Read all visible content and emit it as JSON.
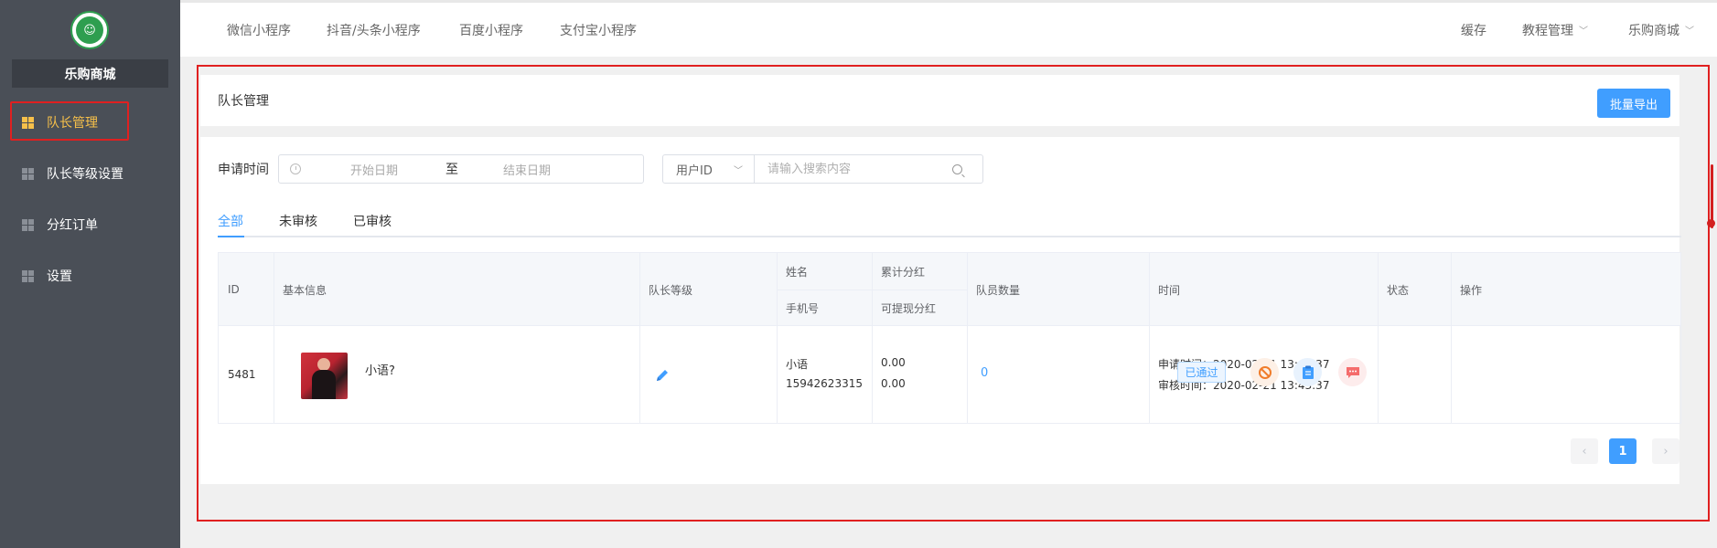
{
  "sidebar": {
    "logo_text": "☺",
    "shop_name": "乐购商城",
    "items": [
      {
        "label": "队长管理",
        "active": true
      },
      {
        "label": "队长等级设置",
        "active": false
      },
      {
        "label": "分红订单",
        "active": false
      },
      {
        "label": "设置",
        "active": false
      }
    ]
  },
  "topbar": {
    "tabs": [
      "微信小程序",
      "抖音/头条小程序",
      "百度小程序",
      "支付宝小程序"
    ],
    "right": {
      "cache": "缓存",
      "tutorial": "教程管理",
      "shop": "乐购商城"
    }
  },
  "card": {
    "title": "队长管理",
    "export_label": "批量导出"
  },
  "filters": {
    "apply_time_label": "申请时间",
    "start_placeholder": "开始日期",
    "separator": "至",
    "end_placeholder": "结束日期",
    "search_field": "用户ID",
    "search_placeholder": "请输入搜索内容"
  },
  "tabs": [
    {
      "label": "全部",
      "active": true
    },
    {
      "label": "未审核",
      "active": false
    },
    {
      "label": "已审核",
      "active": false
    }
  ],
  "table": {
    "headers": {
      "id": "ID",
      "basic": "基本信息",
      "level": "队长等级",
      "name": "姓名",
      "phone": "手机号",
      "total_bonus": "累计分红",
      "withdrawable": "可提现分红",
      "members": "队员数量",
      "time": "时间",
      "status": "状态",
      "ops": "操作"
    },
    "rows": [
      {
        "id": "5481",
        "nickname": "小语?",
        "name": "小语",
        "phone": "15942623315",
        "total_bonus": "0.00",
        "withdrawable": "0.00",
        "members": "0",
        "apply_time": "申请时间：2020-02-21 13:43:37",
        "review_time": "审核时间：2020-02-21 13:43:37",
        "status": "已通过"
      }
    ]
  },
  "pagination": {
    "prev": "‹",
    "current": "1",
    "next": "›"
  },
  "colors": {
    "primary": "#409eff",
    "sidebar_bg": "#4a4f57",
    "active_nav": "#f7c04a",
    "highlight": "#e02020"
  }
}
